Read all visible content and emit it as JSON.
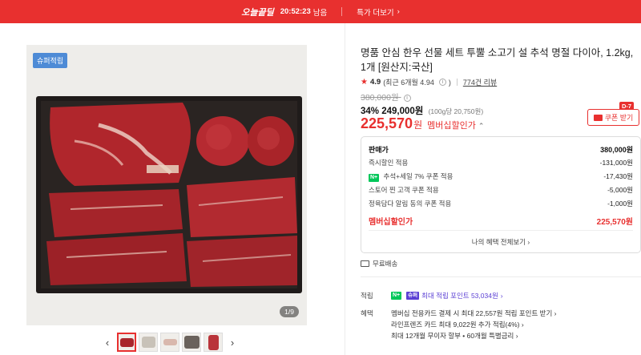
{
  "topbar": {
    "badge": "오늘끝딜",
    "timer": "20:52:23",
    "timer_suffix": "남음",
    "more": "특가 더보기",
    "more_chevron": "›"
  },
  "gallery": {
    "tag": "슈퍼적립",
    "counter": "1/9",
    "prev": "‹",
    "next": "›"
  },
  "product": {
    "title": "명품 안심 한우 선물 세트 투뿔 소고기 설 추석 명절 다이아, 1.2kg, 1개 [원산지:국산]",
    "rating": "4.9",
    "rating_detail": "(최근 6개월 4.94",
    "rating_info": "i",
    "rating_close": ")",
    "review_count": "774건 리뷰",
    "original_price": "380,000원",
    "discount_rate": "34%",
    "discount_price": "249,000원",
    "unit_price": "(100g당 20,750원)",
    "member_price": "225,570",
    "member_won": "원",
    "member_label": "멤버십할인가",
    "member_chevron": "⌃"
  },
  "coupon": {
    "label": "쿠폰 받기",
    "dday": "D-7"
  },
  "breakdown": {
    "rows": [
      {
        "label": "판매가",
        "value": "380,000원"
      },
      {
        "label": "즉시할인 적용",
        "value": "-131,000원"
      },
      {
        "label": "추석+세일 7% 쿠폰 적용",
        "value": "-17,430원",
        "badge": "N+"
      },
      {
        "label": "스토어 찐 고객 쿠폰 적용",
        "value": "-5,000원"
      },
      {
        "label": "정육담다 알림 동의 쿠폰 적용",
        "value": "-1,000원"
      }
    ],
    "final_label": "멤버십할인가",
    "final_value": "225,570원",
    "all_benefits": "나의 혜택 전체보기 ›"
  },
  "shipping": {
    "label": "무료배송"
  },
  "points": {
    "label": "적립",
    "badge_n": "N+",
    "badge_plus": "슈퍼",
    "text": "최대 적립 포인트 53,034원",
    "chevron": "›"
  },
  "benefits": {
    "label": "혜택",
    "items": [
      "멤버십 전용카드 결제 시 최대 22,557원 적립 포인트 받기 ›",
      "라인프렌즈 카드 최대 9,022원 추가 적립(4%) ›",
      "최대 12개월 무이자 할부 • 60개월 특별금리 ›"
    ]
  },
  "colors": {
    "accent": "#e8302f",
    "naver_green": "#03c75a",
    "points_purple": "#5a3fd4",
    "tag_blue": "#4e8bd6"
  }
}
